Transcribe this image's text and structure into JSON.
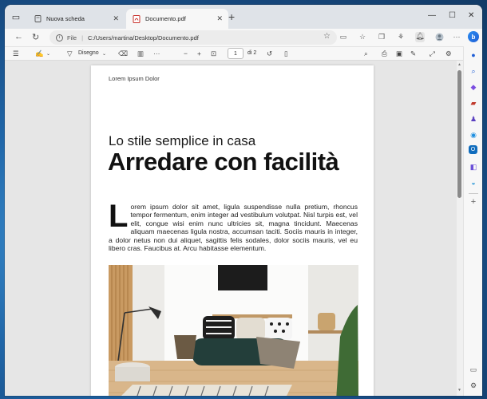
{
  "tabs": {
    "inactive": {
      "label": "Nuova scheda"
    },
    "active": {
      "label": "Documento.pdf"
    }
  },
  "address": {
    "scheme": "File",
    "path": "C:/Users/martina/Desktop/Documento.pdf"
  },
  "pdf_toolbar": {
    "draw_label": "Disegno",
    "page_current": "1",
    "page_total": "di 2"
  },
  "document": {
    "running_head": "Lorem Ipsum Dolor",
    "subtitle": "Lo stile semplice in casa",
    "title": "Arredare con facilità",
    "dropcap": "L",
    "body": "orem ipsum dolor sit amet, ligula suspendisse nulla pretium, rhoncus tempor fermentum, enim integer ad vestibulum volutpat. Nisl turpis est, vel elit, congue wisi enim nunc ultricies sit, magna tincidunt. Maecenas aliquam maecenas ligula nostra, accumsan taciti. Sociis mauris in integer, a dolor netus non dui aliquet, sagittis felis sodales, dolor sociis mauris, vel eu libero cras. Faucibus at. Arcu habitasse elementum."
  },
  "colors": {
    "tab_bar": "#dfe3e8",
    "toolbar": "#f7f7f7",
    "viewer_bg": "#e6e6e6",
    "accent": "#1f5fd6"
  },
  "icons": {
    "sidebar": [
      "bell-icon",
      "search-icon",
      "tag-icon",
      "briefcase-icon",
      "chess-icon",
      "copilot-icon",
      "outlook-icon",
      "designer-icon",
      "games-icon",
      "add-icon"
    ]
  }
}
